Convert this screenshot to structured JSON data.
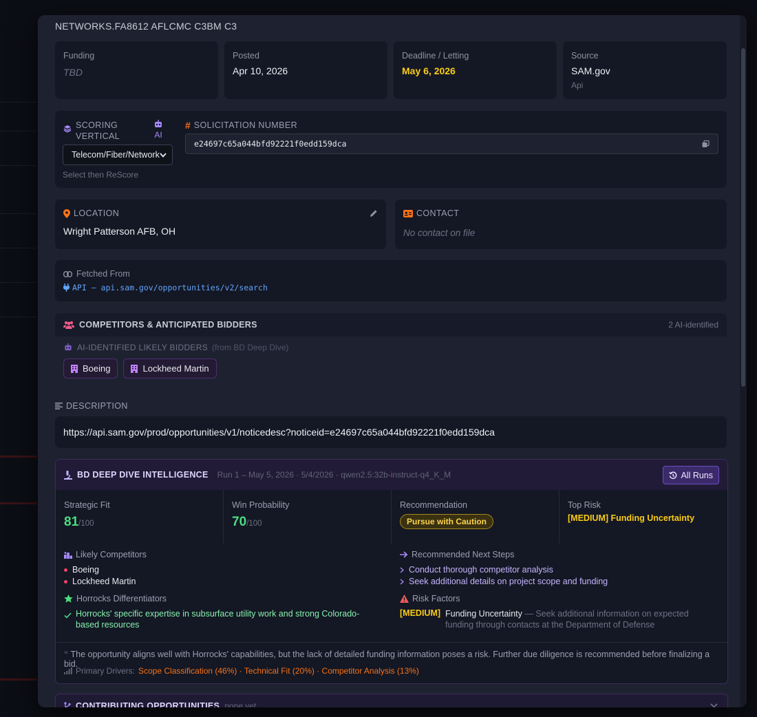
{
  "modal": {
    "title": "NETWORKS.FA8612 AFLCMC C3BM C3"
  },
  "info": {
    "funding": {
      "label": "Funding",
      "value": "TBD"
    },
    "posted": {
      "label": "Posted",
      "value": "Apr 10, 2026"
    },
    "deadline": {
      "label": "Deadline / Letting",
      "value": "May 6, 2026",
      "color": "#facc15"
    },
    "source": {
      "label": "Source",
      "value": "SAM.gov",
      "sub": "Api"
    }
  },
  "scoring": {
    "label": "SCORING VERTICAL",
    "ai_label": "AI",
    "selected": "Telecom/Fiber/Network",
    "hint": "Select then ReScore"
  },
  "solicitation": {
    "label": "SOLICITATION NUMBER",
    "value": "e24697c65a044bfd92221f0edd159dca"
  },
  "location": {
    "label": "LOCATION",
    "value": "Wright Patterson AFB, OH"
  },
  "contact": {
    "label": "CONTACT",
    "value": "No contact on file"
  },
  "fetched": {
    "label": "Fetched From",
    "value": "API — api.sam.gov/opportunities/v2/search"
  },
  "competitors": {
    "title": "COMPETITORS & ANTICIPATED BIDDERS",
    "count": "2 AI-identified",
    "sub_label": "AI-IDENTIFIED LIKELY BIDDERS",
    "sub_note": "(from BD Deep Dive)",
    "chips": [
      "Boeing",
      "Lockheed Martin"
    ]
  },
  "description": {
    "label": "DESCRIPTION",
    "value": "https://api.sam.gov/prod/opportunities/v1/noticedesc?noticeid=e24697c65a044bfd92221f0edd159dca"
  },
  "bd": {
    "title": "BD DEEP DIVE INTELLIGENCE",
    "run": "Run 1 – May 5, 2026 · 5/4/2026 · qwen2.5:32b-instruct-q4_K_M",
    "all_runs": "All Runs",
    "strategic_fit": {
      "label": "Strategic Fit",
      "value": "81",
      "max": "/100"
    },
    "win_probability": {
      "label": "Win Probability",
      "value": "70",
      "max": "/100"
    },
    "recommendation": {
      "label": "Recommendation",
      "value": "Pursue with Caution"
    },
    "top_risk": {
      "label": "Top Risk",
      "value": "[MEDIUM] Funding Uncertainty"
    },
    "likely_competitors": {
      "label": "Likely Competitors",
      "items": [
        "Boeing",
        "Lockheed Martin"
      ]
    },
    "differentiators": {
      "label": "Horrocks Differentiators",
      "items": [
        "Horrocks' specific expertise in subsurface utility work and strong Colorado-based resources"
      ]
    },
    "next_steps": {
      "label": "Recommended Next Steps",
      "items": [
        "Conduct thorough competitor analysis",
        "Seek additional details on project scope and funding"
      ]
    },
    "risk_factors": {
      "label": "Risk Factors",
      "level": "[MEDIUM]",
      "name": "Funding Uncertainty",
      "detail": " — Seek additional information on expected funding through contacts at the Department of Defense"
    },
    "summary": "The opportunity aligns well with Horrocks' capabilities, but the lack of detailed funding information poses a risk. Further due diligence is recommended before finalizing a bid.",
    "drivers_label": "Primary Drivers:",
    "drivers": "Scope Classification (46%) · Technical Fit (20%) · Competitor Analysis (13%)"
  },
  "contributing": {
    "title": "CONTRIBUTING OPPORTUNITIES",
    "note": "none yet"
  },
  "colors": {
    "accent_purple": "#a78bfa",
    "accent_orange": "#f97316",
    "success": "#4ade80",
    "warning": "#facc15"
  }
}
